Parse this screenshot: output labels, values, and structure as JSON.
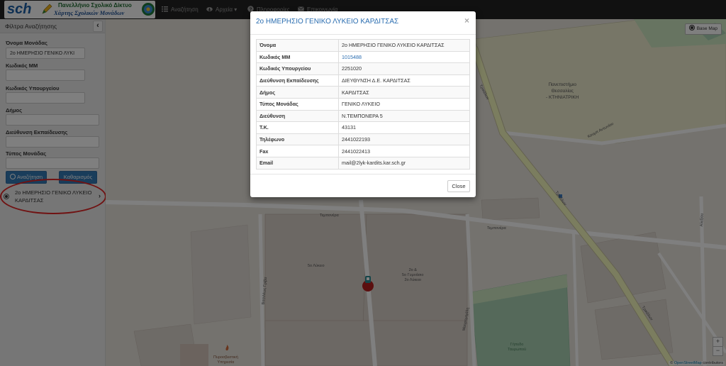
{
  "navbar": {
    "logo": {
      "brand": "sch",
      "line1": "Πανελλήνιο Σχολικό Δίκτυο",
      "line2": "Χάρτης Σχολικών Μονάδων"
    },
    "items": [
      {
        "label": "Αναζήτηση",
        "icon": "list-icon"
      },
      {
        "label": "Αρχεία",
        "icon": "cloud-download-icon",
        "caret": "▾"
      },
      {
        "label": "Πληροφορίες",
        "icon": "question-circle-icon"
      },
      {
        "label": "Επικοινωνία",
        "icon": "envelope-icon"
      }
    ]
  },
  "sidebar": {
    "title": "Φίλτρα Αναζήτησης",
    "collapse_glyph": "‹",
    "fields": [
      {
        "label": "Όνομα Μονάδας",
        "value": "2ο ΗΜΕΡΗΣΙΟ ΓΕΝΙΚΟ ΛΥΚΙ"
      },
      {
        "label": "Κωδικός ΜΜ",
        "value": ""
      },
      {
        "label": "Κωδικός Υπουργείου",
        "value": ""
      },
      {
        "label": "Δήμος",
        "value": ""
      },
      {
        "label": "Διεύθυνση Εκπαίδευσης",
        "value": ""
      },
      {
        "label": "Τύπος Μονάδας",
        "value": ""
      }
    ],
    "search_button": "Αναζήτηση",
    "clear_button": "Καθαρισμός",
    "result": {
      "name": "2ο ΗΜΕΡΗΣΙΟ ΓΕΝΙΚΟ ΛΥΚΕΙΟ ΚΑΡΔΙΤΣΑΣ",
      "chevron": "›"
    },
    "highlight_color": "#e02424"
  },
  "map": {
    "base_map_label": "Base Map",
    "zoom_in": "+",
    "zoom_out": "−",
    "attribution_symbol": "©",
    "attribution_link": "OpenStreetMap",
    "attribution_rest": "contributors",
    "labels": {
      "university": [
        "Πανεπιστήμιο",
        "Θεσσαλίας",
        "- ΚΤΗΝΙΑΤΡΙΚΗ"
      ],
      "street_tempo_1": "Τεμπονέρα",
      "street_tempo_2": "Τεμπονέρα",
      "street_trikalon_1": "Τρικάλων",
      "street_trikalon_2": "Τρικάλων",
      "street_trikalon_3": "Τρικάλων",
      "street_vasileos": "Βασιλέως Γρίβα",
      "street_mavromichali": "Μαυρομιχάλη",
      "street_alexiou": "Αλεξίου",
      "street_kapodistriou": "Κουμπ Αντωνίου",
      "lyceum_5": "5ο Λύκειο",
      "lyceum_2": [
        "2ο &",
        "5ο Γυμνάσιο",
        "2ο Λύκειο"
      ],
      "stadium": [
        "Γήπεδο",
        "Ταυρωπού"
      ],
      "fire": [
        "Πυροσβεστική",
        "Υπηρεσία"
      ]
    },
    "colors": {
      "land": "#e8e4dd",
      "block": "#d9d0c9",
      "building": "#c9b8ad",
      "park": "#cfe8c3",
      "pitch": "#aad3b5",
      "road_major": "#f7fabf",
      "road_minor": "#ffffff",
      "marker": "#b61e1e",
      "marker_pin": "#2a8a92"
    }
  },
  "modal": {
    "title": "2ο ΗΜΕΡΗΣΙΟ ΓΕΝΙΚΟ ΛΥΚΕΙΟ ΚΑΡΔΙΤΣΑΣ",
    "close_x": "×",
    "rows": [
      {
        "label": "Όνομα",
        "value": "2ο ΗΜΕΡΗΣΙΟ ΓΕΝΙΚΟ ΛΥΚΕΙΟ ΚΑΡΔΙΤΣΑΣ"
      },
      {
        "label": "Κωδικός ΜΜ",
        "value": "1015488",
        "link": true
      },
      {
        "label": "Κωδικός Υπουργείου",
        "value": "2251020"
      },
      {
        "label": "Διεύθυνση Εκπαίδευσης",
        "value": "ΔΙΕΥΘΥΝΣΗ Δ.Ε. ΚΑΡΔΙΤΣΑΣ"
      },
      {
        "label": "Δήμος",
        "value": "ΚΑΡΔΙΤΣΑΣ"
      },
      {
        "label": "Τύπος Μονάδας",
        "value": "ΓΕΝΙΚΟ ΛΥΚΕΙΟ"
      },
      {
        "label": "Διεύθυνση",
        "value": "Ν.ΤΕΜΠΟΝΕΡΑ 5"
      },
      {
        "label": "Τ.Κ.",
        "value": "43131"
      },
      {
        "label": "Τηλέφωνο",
        "value": "2441022193"
      },
      {
        "label": "Fax",
        "value": "2441022413"
      },
      {
        "label": "Email",
        "value": "mail@2lyk-kardits.kar.sch.gr"
      }
    ],
    "close_button": "Close"
  }
}
